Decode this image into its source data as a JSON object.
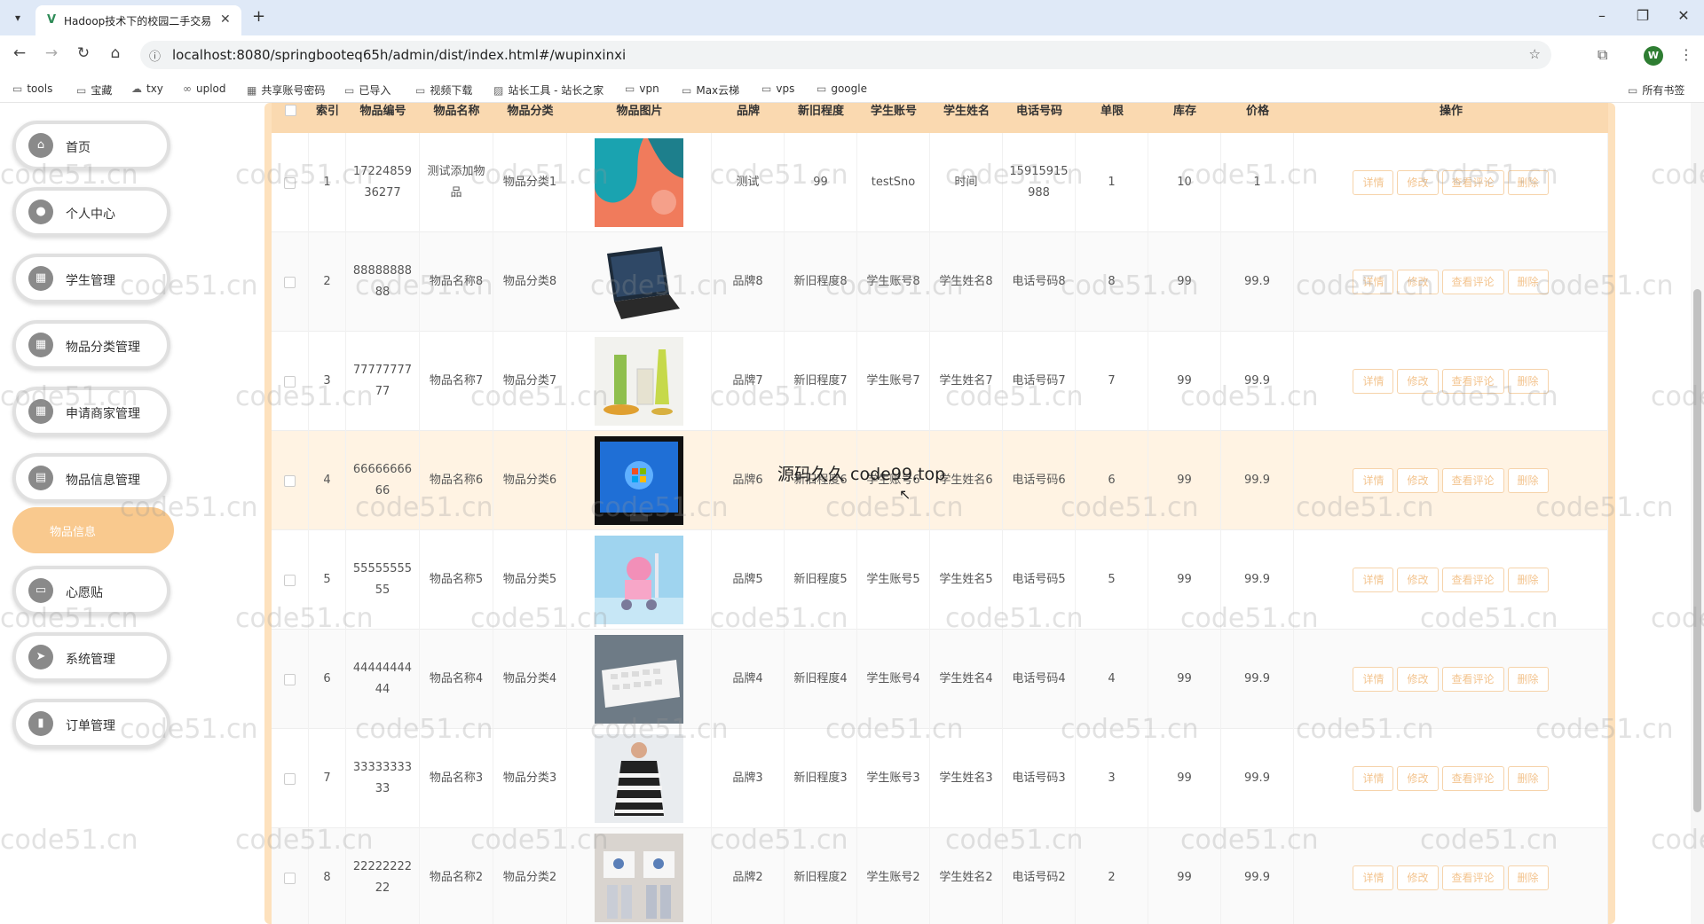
{
  "browser": {
    "tab_title": "Hadoop技术下的校园二手交易",
    "url": "localhost:8080/springbooteq65h/admin/dist/index.html#/wupinxinxi",
    "profile_initial": "W",
    "bookmarks": [
      "tools",
      "宝藏",
      "txy",
      "uplod",
      "共享账号密码",
      "已导入",
      "视频下载",
      "站长工具 - 站长之家",
      "vpn",
      "Max云梯",
      "vps",
      "google"
    ],
    "all_bookmarks": "所有书签"
  },
  "sidebar": {
    "items": [
      {
        "label": "首页",
        "icon": "home-icon"
      },
      {
        "label": "个人中心",
        "icon": "user-icon"
      },
      {
        "label": "学生管理",
        "icon": "grid-icon"
      },
      {
        "label": "物品分类管理",
        "icon": "grid-icon"
      },
      {
        "label": "申请商家管理",
        "icon": "grid-icon"
      },
      {
        "label": "物品信息管理",
        "icon": "doc-icon"
      },
      {
        "label": "心愿贴",
        "icon": "card-icon"
      },
      {
        "label": "系统管理",
        "icon": "send-icon"
      },
      {
        "label": "订单管理",
        "icon": "chart-icon"
      }
    ],
    "sub_item": "物品信息"
  },
  "table": {
    "headers": [
      "索引",
      "物品编号",
      "物品名称",
      "物品分类",
      "物品图片",
      "品牌",
      "新旧程度",
      "学生账号",
      "学生姓名",
      "电话号码",
      "单限",
      "库存",
      "价格",
      "操作"
    ],
    "actions": [
      "详情",
      "修改",
      "查看评论",
      "删除"
    ],
    "rows": [
      {
        "index": "1",
        "code": "1722485936277",
        "name": "测试添加物品",
        "category": "物品分类1",
        "image": "abstract-art",
        "brand": "测试",
        "condition": "99",
        "account": "testSno",
        "student": "时间",
        "phone": "15915915988",
        "limit": "1",
        "stock": "10",
        "price": "1"
      },
      {
        "index": "2",
        "code": "8888888888",
        "name": "物品名称8",
        "category": "物品分类8",
        "image": "laptop",
        "brand": "品牌8",
        "condition": "新旧程度8",
        "account": "学生账号8",
        "student": "学生姓名8",
        "phone": "电话号码8",
        "limit": "8",
        "stock": "99",
        "price": "99.9"
      },
      {
        "index": "3",
        "code": "7777777777",
        "name": "物品名称7",
        "category": "物品分类7",
        "image": "cosmetics",
        "brand": "品牌7",
        "condition": "新旧程度7",
        "account": "学生账号7",
        "student": "学生姓名7",
        "phone": "电话号码7",
        "limit": "7",
        "stock": "99",
        "price": "99.9"
      },
      {
        "index": "4",
        "code": "6666666666",
        "name": "物品名称6",
        "category": "物品分类6",
        "image": "monitor",
        "brand": "品牌6",
        "condition": "新旧程度6",
        "account": "学生账号6",
        "student": "学生姓名6",
        "phone": "电话号码6",
        "limit": "6",
        "stock": "99",
        "price": "99.9"
      },
      {
        "index": "5",
        "code": "5555555555",
        "name": "物品名称5",
        "category": "物品分类5",
        "image": "toy",
        "brand": "品牌5",
        "condition": "新旧程度5",
        "account": "学生账号5",
        "student": "学生姓名5",
        "phone": "电话号码5",
        "limit": "5",
        "stock": "99",
        "price": "99.9"
      },
      {
        "index": "6",
        "code": "4444444444",
        "name": "物品名称4",
        "category": "物品分类4",
        "image": "keyboard",
        "brand": "品牌4",
        "condition": "新旧程度4",
        "account": "学生账号4",
        "student": "学生姓名4",
        "phone": "电话号码4",
        "limit": "4",
        "stock": "99",
        "price": "99.9"
      },
      {
        "index": "7",
        "code": "3333333333",
        "name": "物品名称3",
        "category": "物品分类3",
        "image": "dress",
        "brand": "品牌3",
        "condition": "新旧程度3",
        "account": "学生账号3",
        "student": "学生姓名3",
        "phone": "电话号码3",
        "limit": "3",
        "stock": "99",
        "price": "99.9"
      },
      {
        "index": "8",
        "code": "2222222222",
        "name": "物品名称2",
        "category": "物品分类2",
        "image": "kids-clothes",
        "brand": "品牌2",
        "condition": "新旧程度2",
        "account": "学生账号2",
        "student": "学生姓名2",
        "phone": "电话号码2",
        "limit": "2",
        "stock": "99",
        "price": "99.9"
      }
    ]
  },
  "overlay_text": "源码久久 code99.top",
  "watermark": "code51.cn",
  "colors": {
    "accent": "#f9c98e",
    "header_bg": "#fad9b0",
    "action_text": "#f3c48f"
  }
}
